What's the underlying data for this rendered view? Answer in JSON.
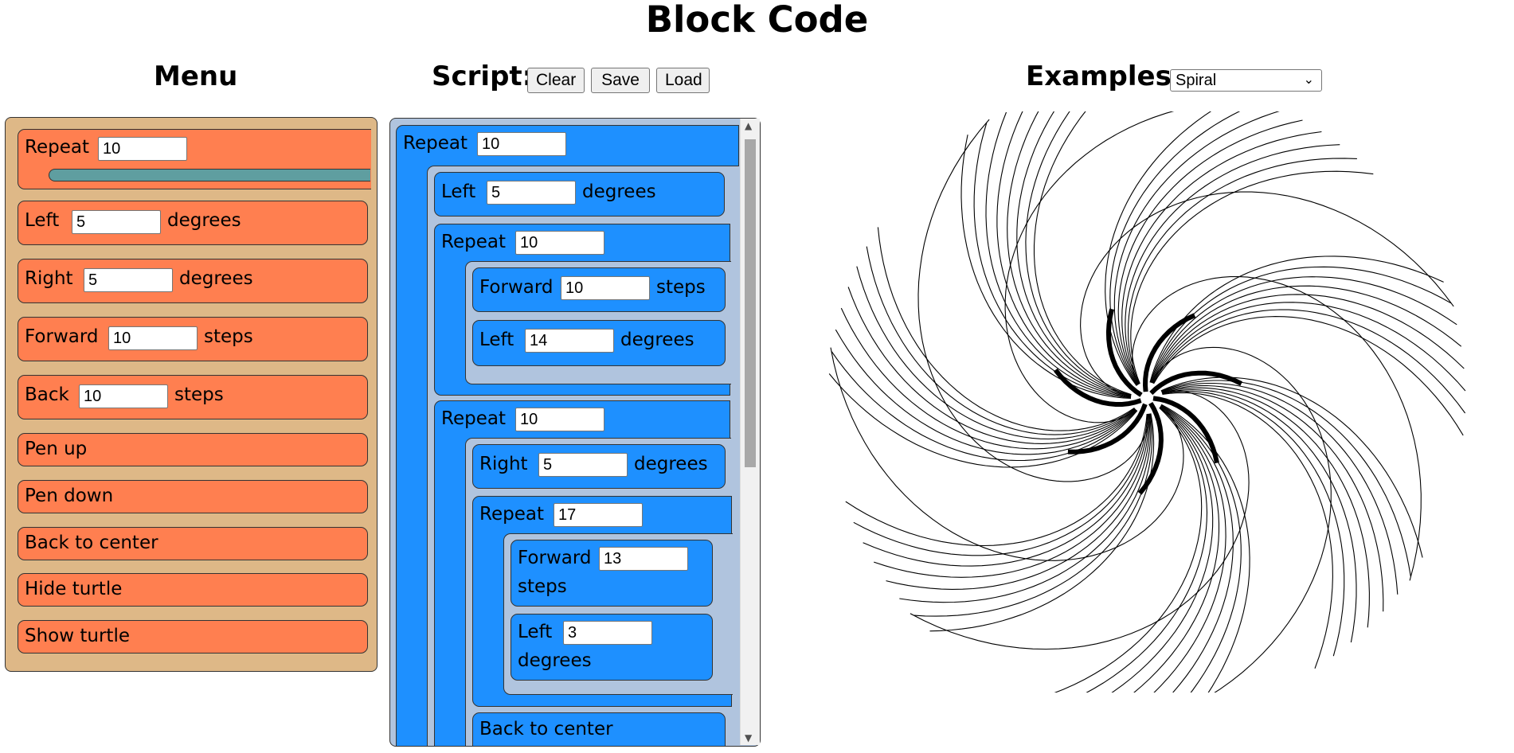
{
  "page_title": "Block Code",
  "menu": {
    "title": "Menu",
    "repeat": {
      "label": "Repeat",
      "value": "10"
    },
    "left": {
      "label": "Left",
      "value": "5",
      "suffix": "degrees"
    },
    "right": {
      "label": "Right",
      "value": "5",
      "suffix": "degrees"
    },
    "forward": {
      "label": "Forward",
      "value": "10",
      "suffix": "steps"
    },
    "back": {
      "label": "Back",
      "value": "10",
      "suffix": "steps"
    },
    "pen_up": "Pen up",
    "pen_down": "Pen down",
    "back_to_center": "Back to center",
    "hide_turtle": "Hide turtle",
    "show_turtle": "Show turtle"
  },
  "script": {
    "title": "Script:",
    "clear": "Clear",
    "save": "Save",
    "load": "Load",
    "blocks": {
      "repeat1": {
        "label": "Repeat",
        "value": "10"
      },
      "left1": {
        "label": "Left",
        "value": "5",
        "suffix": "degrees"
      },
      "repeat2": {
        "label": "Repeat",
        "value": "10"
      },
      "forward1": {
        "label": "Forward",
        "value": "10",
        "suffix": "steps"
      },
      "left2": {
        "label": "Left",
        "value": "14",
        "suffix": "degrees"
      },
      "repeat3": {
        "label": "Repeat",
        "value": "10"
      },
      "right1": {
        "label": "Right",
        "value": "5",
        "suffix": "degrees"
      },
      "repeat4": {
        "label": "Repeat",
        "value": "17"
      },
      "forward2": {
        "label": "Forward",
        "value": "13",
        "suffix": "steps"
      },
      "left3": {
        "label": "Left",
        "value": "3",
        "suffix": "degrees"
      },
      "back_to_center": "Back to center"
    }
  },
  "examples": {
    "title": "Examples:",
    "selected": "Spiral"
  },
  "colors": {
    "menu_panel": "#deb887",
    "menu_block": "#ff7f50",
    "repeat_bar": "#5f9ea0",
    "script_panel": "#b0c4de",
    "script_block": "#1e90ff"
  }
}
